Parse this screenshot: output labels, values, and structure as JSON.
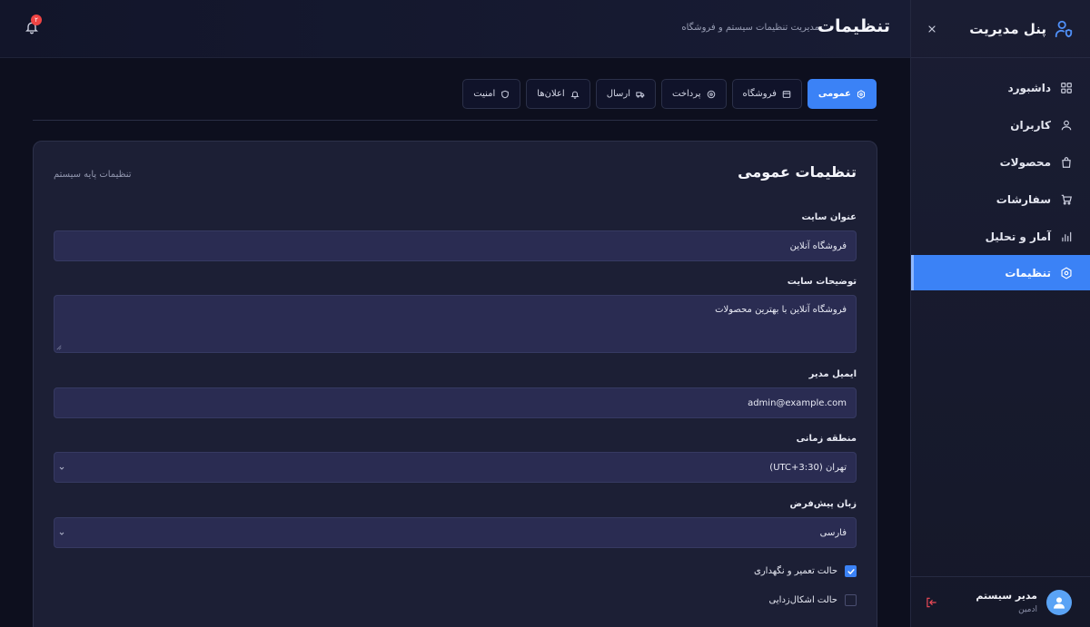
{
  "sidebar": {
    "title": "پنل مدیریت",
    "items": [
      {
        "label": "داشبورد",
        "icon": "dashboard-icon"
      },
      {
        "label": "کاربران",
        "icon": "user-icon"
      },
      {
        "label": "محصولات",
        "icon": "bag-icon"
      },
      {
        "label": "سفارشات",
        "icon": "cart-icon"
      },
      {
        "label": "آمار و تحلیل",
        "icon": "chart-icon"
      },
      {
        "label": "تنظیمات",
        "icon": "settings-icon",
        "active": true
      }
    ],
    "user": {
      "name": "مدیر سیستم",
      "role": "ادمین"
    }
  },
  "header": {
    "title": "تنظیمات",
    "subtitle": "مدیریت تنظیمات سیستم و فروشگاه",
    "notification_count": "۲"
  },
  "tabs": [
    {
      "label": "عمومی",
      "icon": "settings-icon",
      "active": true
    },
    {
      "label": "فروشگاه",
      "icon": "store-icon"
    },
    {
      "label": "پرداخت",
      "icon": "payment-icon"
    },
    {
      "label": "ارسال",
      "icon": "truck-icon"
    },
    {
      "label": "اعلان‌ها",
      "icon": "bell-icon"
    },
    {
      "label": "امنیت",
      "icon": "shield-icon"
    }
  ],
  "card": {
    "title": "تنظیمات عمومی",
    "subtitle": "تنظیمات پایه سیستم"
  },
  "form": {
    "site_title_label": "عنوان سایت",
    "site_title_value": "فروشگاه آنلاین",
    "site_desc_label": "توضیحات سایت",
    "site_desc_value": "فروشگاه آنلاین با بهترین محصولات",
    "admin_email_label": "ایمیل مدیر",
    "admin_email_value": "admin@example.com",
    "timezone_label": "منطقه زمانی",
    "timezone_value": "تهران (UTC+3:30)",
    "language_label": "زبان پیش‌فرض",
    "language_value": "فارسی",
    "maintenance_label": "حالت تعمیر و نگهداری",
    "maintenance_checked": true,
    "debug_label": "حالت اشکال‌زدایی",
    "debug_checked": false
  },
  "colors": {
    "accent": "#3b82f6",
    "background": "#0d0f1e",
    "card": "#1c1f35",
    "input": "#2a2c52",
    "danger": "#ef4444"
  }
}
